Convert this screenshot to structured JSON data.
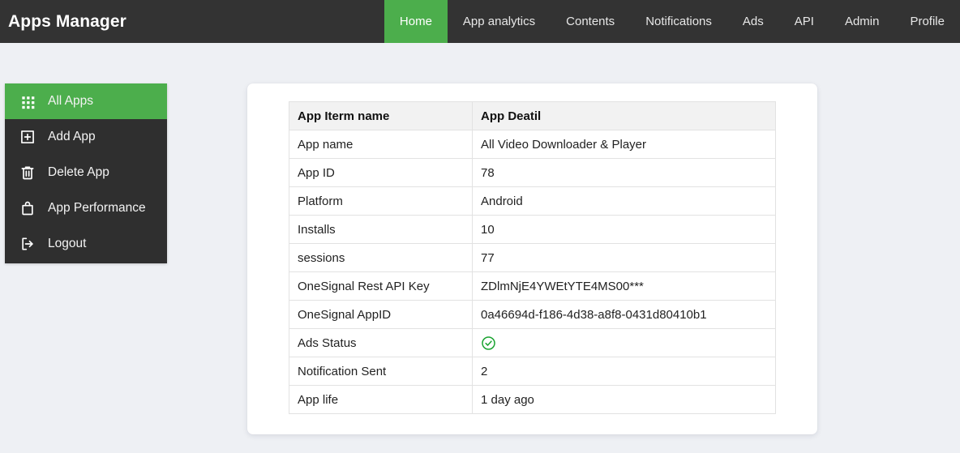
{
  "navbar": {
    "brand": "Apps Manager",
    "items": [
      {
        "label": "Home",
        "active": true
      },
      {
        "label": "App analytics",
        "active": false
      },
      {
        "label": "Contents",
        "active": false
      },
      {
        "label": "Notifications",
        "active": false
      },
      {
        "label": "Ads",
        "active": false
      },
      {
        "label": "API",
        "active": false
      },
      {
        "label": "Admin",
        "active": false
      },
      {
        "label": "Profile",
        "active": false
      }
    ],
    "background_color": "#333333",
    "active_color": "#4cae4c"
  },
  "sidebar": {
    "items": [
      {
        "label": "All Apps",
        "icon": "grid-icon",
        "active": true
      },
      {
        "label": "Add App",
        "icon": "plus-square-icon",
        "active": false
      },
      {
        "label": "Delete App",
        "icon": "trash-icon",
        "active": false
      },
      {
        "label": "App Performance",
        "icon": "bag-icon",
        "active": false
      },
      {
        "label": "Logout",
        "icon": "logout-icon",
        "active": false
      }
    ],
    "background_color": "#2f2f2f",
    "active_color": "#4cae4c"
  },
  "table": {
    "headers": [
      "App Iterm name",
      "App Deatil"
    ],
    "rows": [
      {
        "name": "App name",
        "value": "All Video Downloader & Player",
        "type": "text"
      },
      {
        "name": "App ID",
        "value": "78",
        "type": "text"
      },
      {
        "name": "Platform",
        "value": "Android",
        "type": "text"
      },
      {
        "name": "Installs",
        "value": "10",
        "type": "text"
      },
      {
        "name": "sessions",
        "value": "77",
        "type": "text"
      },
      {
        "name": "OneSignal Rest API Key",
        "value": "ZDlmNjE4YWEtYTE4MS00***",
        "type": "text"
      },
      {
        "name": "OneSignal AppID",
        "value": "0a46694d-f186-4d38-a8f8-0431d80410b1",
        "type": "text"
      },
      {
        "name": "Ads Status",
        "value": "",
        "type": "check-circle-icon",
        "icon_color": "#19a330"
      },
      {
        "name": "Notification Sent",
        "value": "2",
        "type": "text"
      },
      {
        "name": "App life",
        "value": "1 day ago",
        "type": "text"
      }
    ]
  }
}
